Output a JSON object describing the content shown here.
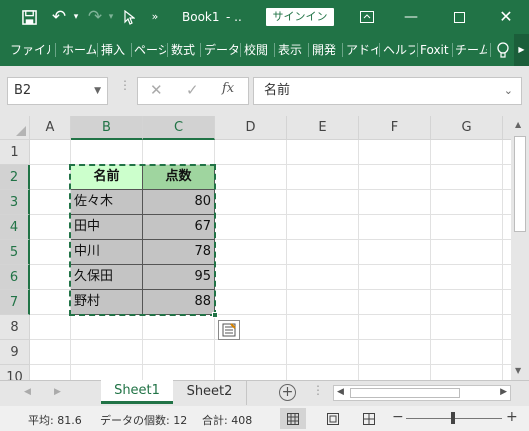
{
  "title": {
    "workbook": "Book1",
    "suffix": "- ..",
    "signin": "サインイン"
  },
  "ribbon_tabs": [
    "ファイル",
    "ホーム",
    "挿入",
    "ページ",
    "数式",
    "データ",
    "校閲",
    "表示",
    "開発",
    "アドイ",
    "ヘルプ",
    "Foxit",
    "チーム"
  ],
  "name_box": "B2",
  "formula": "名前",
  "columns": [
    "A",
    "B",
    "C",
    "D",
    "E",
    "F",
    "G"
  ],
  "rows": [
    "1",
    "2",
    "3",
    "4",
    "5",
    "6",
    "7",
    "8",
    "9",
    "10"
  ],
  "table": {
    "header": [
      "名前",
      "点数"
    ],
    "data": [
      [
        "佐々木",
        "80"
      ],
      [
        "田中",
        "67"
      ],
      [
        "中川",
        "78"
      ],
      [
        "久保田",
        "95"
      ],
      [
        "野村",
        "88"
      ]
    ]
  },
  "sheets": [
    "Sheet1",
    "Sheet2"
  ],
  "status": {
    "average": "平均: 81.6",
    "count": "データの個数: 12",
    "sum": "合計: 408"
  },
  "colors": {
    "excel_green": "#217346",
    "header_fill": "#ccffcc",
    "header_fill_c": "#9fd59f",
    "data_fill": "#c4c4c4"
  }
}
